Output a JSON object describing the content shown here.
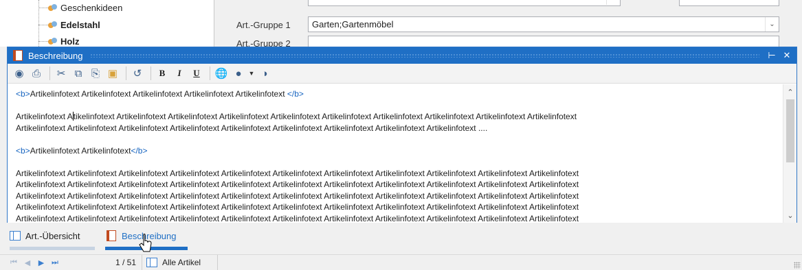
{
  "tree": {
    "items": [
      {
        "label": "Geschenkideen"
      },
      {
        "label": "Edelstahl"
      },
      {
        "label": "Holz"
      }
    ]
  },
  "form": {
    "group1_label": "Art.-Gruppe 1",
    "group1_value": "Garten;Gartenmöbel",
    "group2_label": "Art.-Gruppe 2"
  },
  "dock": {
    "title": "Beschreibung",
    "pin_icon": "pin-icon",
    "close_icon": "close-icon"
  },
  "toolbar": {
    "bold_label": "B",
    "italic_label": "I",
    "underline_label": "U"
  },
  "editor": {
    "line1_tag_open": "<b>",
    "line1_text": "Artikelinfotext Artikelinfotext Artikelinfotext Artikelinfotext Artikelinfotext ",
    "line1_tag_close": "</b>",
    "line2_start": "Artikelinfotext A",
    "line2_rest": "tikelinfotext Artikelinfotext Artikelinfotext Artikelinfotext Artikelinfotext Artikelinfotext Artikelinfotext Artikelinfotext Artikelinfotext Artikelinfotext",
    "line3_text": "Artikelinfotext Artikelinfotext Artikelinfotext Artikelinfotext Artikelinfotext Artikelinfotext Artikelinfotext Artikelinfotext Artikelinfotext ....",
    "line4_tag_open": "<b>",
    "line4_text": "Artikelinfotext Artikelinfotext",
    "line4_tag_close": "</b>",
    "para_line": "Artikelinfotext Artikelinfotext Artikelinfotext Artikelinfotext Artikelinfotext Artikelinfotext Artikelinfotext Artikelinfotext Artikelinfotext Artikelinfotext Artikelinfotext"
  },
  "tabs": [
    {
      "label": "Art.-Übersicht"
    },
    {
      "label": "Beschreibung"
    }
  ],
  "statusbar": {
    "position": "1 / 51",
    "filter_label": "Alle Artikel"
  },
  "colors": {
    "accent": "#1f6fc5",
    "tag": "#1664c0",
    "tab_inactive_underline": "#c7d3e2",
    "tab_active_underline": "#1f6fc5"
  }
}
